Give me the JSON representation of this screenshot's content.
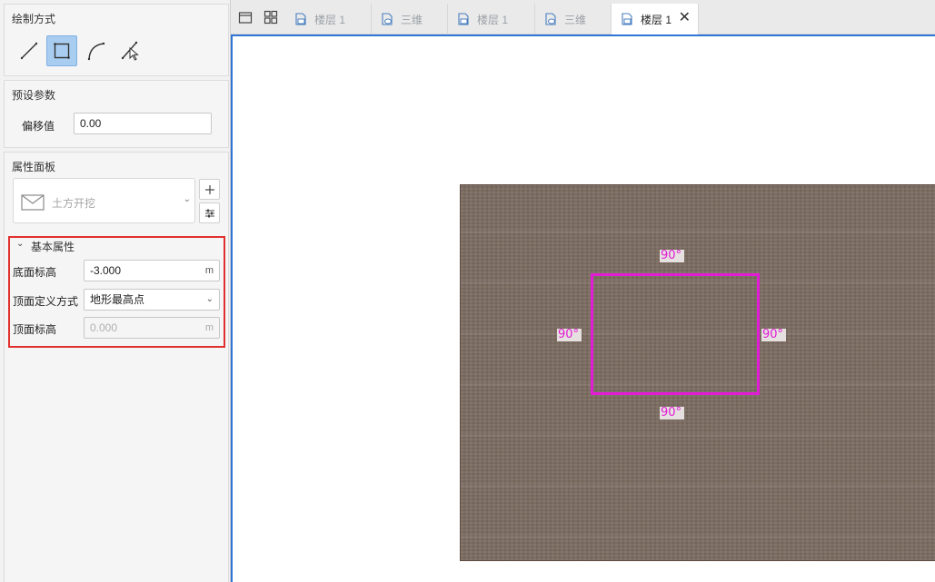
{
  "draw_method": {
    "title": "绘制方式",
    "tools": [
      {
        "name": "line",
        "icon": "line-tool-icon"
      },
      {
        "name": "rectangle",
        "icon": "rectangle-tool-icon",
        "active": true
      },
      {
        "name": "arc",
        "icon": "arc-tool-icon"
      },
      {
        "name": "pick",
        "icon": "pick-line-tool-icon"
      }
    ]
  },
  "preset": {
    "title": "预设参数",
    "offset_label": "偏移值",
    "offset_value": "0.00"
  },
  "properties": {
    "title": "属性面板",
    "type_name": "土方开挖",
    "group_title": "基本属性",
    "bottom_elev_label": "底面标高",
    "bottom_elev_value": "-3.000",
    "bottom_elev_unit": "m",
    "top_def_label": "顶面定义方式",
    "top_def_value": "地形最高点",
    "top_elev_label": "顶面标高",
    "top_elev_value": "0.000",
    "top_elev_unit": "m"
  },
  "tabs": [
    {
      "label": "楼层 1",
      "kind": "floor"
    },
    {
      "label": "三维",
      "kind": "3d"
    },
    {
      "label": "楼层 1",
      "kind": "floor"
    },
    {
      "label": "三维",
      "kind": "3d"
    },
    {
      "label": "楼层 1",
      "kind": "floor",
      "active": true
    }
  ],
  "canvas": {
    "angles": {
      "top": "90°",
      "left": "90°",
      "right": "90°",
      "bottom": "90°"
    },
    "sketch_color": "#e21bd5",
    "accent_color": "#2f75d6"
  }
}
